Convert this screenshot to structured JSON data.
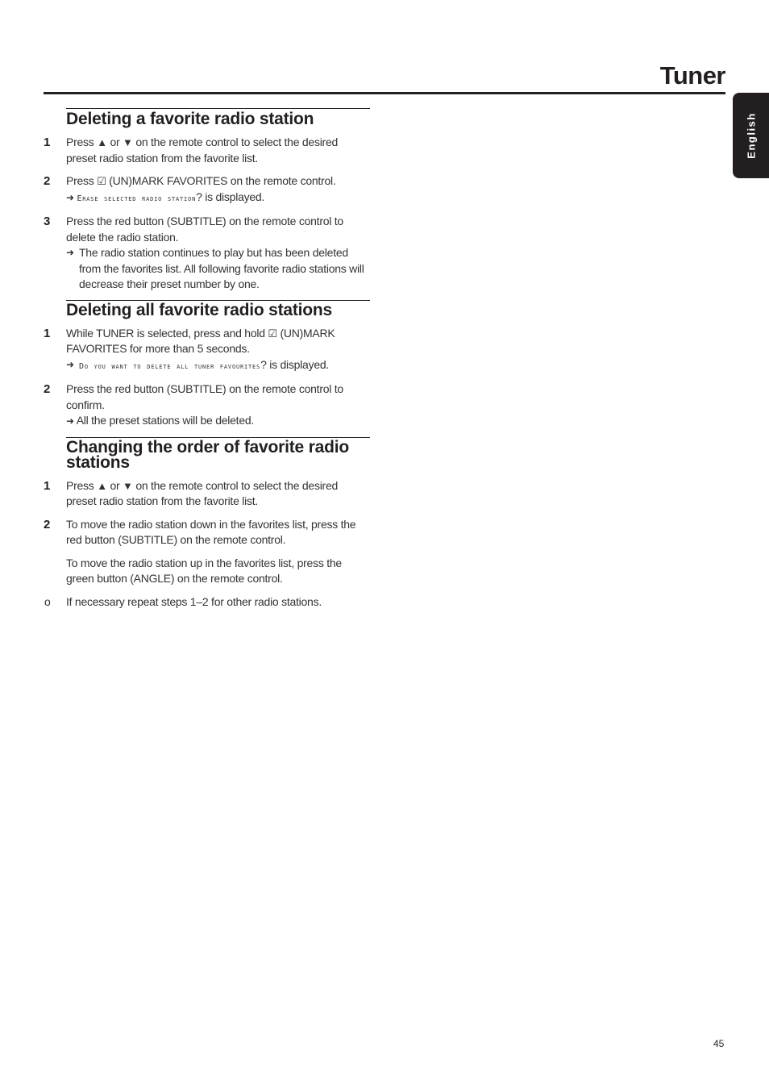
{
  "header": {
    "title": "Tuner",
    "language_tab": "English"
  },
  "sections": [
    {
      "heading": "Deleting a favorite radio station",
      "steps": [
        {
          "num": "1",
          "pre": "Press",
          "icon1": "▲",
          "mid": "or",
          "icon2": "▼",
          "post": "on the remote control to select the desired preset radio station from the favorite list."
        },
        {
          "num": "2",
          "pre": "Press",
          "icon": "☑",
          "post": "(UN)MARK FAVORITES on the remote control.",
          "result_lcd": "Erase selected radio station",
          "result_post": "? is displayed."
        },
        {
          "num": "3",
          "text": "Press the red button (SUBTITLE) on the remote control to delete the radio station.",
          "result": "The radio station continues to play but has been deleted from the favorites list. All following favorite radio stations will decrease their preset number by one."
        }
      ]
    },
    {
      "heading": "Deleting all favorite radio stations",
      "steps": [
        {
          "num": "1",
          "pre": "While TUNER is selected, press and hold",
          "icon": "☑",
          "post": "(UN)MARK FAVORITES for more than 5 seconds.",
          "result_lcd": "Do you want to delete all tuner favourites",
          "result_post": "? is displayed."
        },
        {
          "num": "2",
          "text": "Press the red button (SUBTITLE) on the remote control to confirm.",
          "result": "All the preset stations will be deleted."
        }
      ]
    },
    {
      "heading": "Changing the order of favorite radio stations",
      "steps": [
        {
          "num": "1",
          "pre": "Press",
          "icon1": "▲",
          "mid": "or",
          "icon2": "▼",
          "post": "on the remote control to select the desired preset radio station from the favorite list."
        },
        {
          "num": "2",
          "text": "To move the radio station down in the favorites list, press the red button (SUBTITLE) on the remote control.",
          "para": "To move the radio station up in the favorites list, press the green button (ANGLE) on the remote control."
        },
        {
          "num": "o",
          "text": "If necessary repeat steps 1–2 for other radio stations."
        }
      ]
    }
  ],
  "result_arrow": "➜",
  "page_number": "45"
}
